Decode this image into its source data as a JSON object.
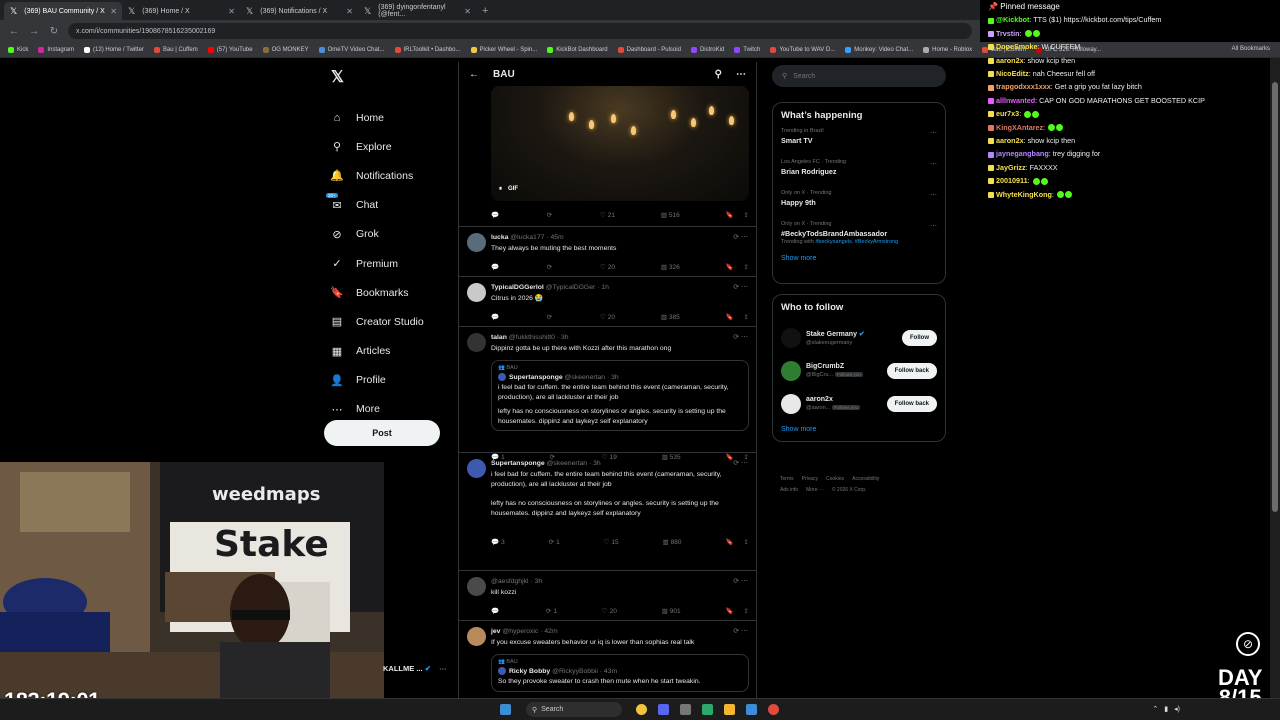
{
  "browser": {
    "tabs": [
      {
        "title": "(369) BAU Community / X",
        "active": true
      },
      {
        "title": "(369) Home / X",
        "active": false
      },
      {
        "title": "(369) Notifications / X",
        "active": false
      },
      {
        "title": "(369) dyingonfentanyl (@fent...",
        "active": false
      }
    ],
    "url": "x.com/i/communities/1908678516235002169",
    "bookmarks": [
      "Kick",
      "Instagram",
      "(12) Home / Twitter",
      "Bau | Cuffem",
      "(57) YouTube",
      "OG MONKEY",
      "OmeTV Video Chat...",
      "IRLToolkit • Dashbo...",
      "Picker Wheel - Spin...",
      "KickBot Dashboard",
      "Dashboard - Pulsoid",
      "DistroKid",
      "Twitch",
      "YouTube to WAV D...",
      "Monkey: Video Chat...",
      "Home - Roblox",
      "Bau | Cuffem",
      "UFC 326: Holloway..."
    ],
    "all_bookmarks": "All Bookmarks"
  },
  "x": {
    "logo": "𝕏",
    "nav": [
      {
        "label": "Home",
        "icon": "home-icon",
        "glyph": "⌂"
      },
      {
        "label": "Explore",
        "icon": "search-icon",
        "glyph": "⚲"
      },
      {
        "label": "Notifications",
        "icon": "bell-icon",
        "glyph": "🔔"
      },
      {
        "label": "Chat",
        "icon": "chat-icon",
        "glyph": "✉",
        "badge": "20+"
      },
      {
        "label": "Grok",
        "icon": "grok-icon",
        "glyph": "⊘"
      },
      {
        "label": "Premium",
        "icon": "premium-icon",
        "glyph": "✓"
      },
      {
        "label": "Bookmarks",
        "icon": "bookmark-icon",
        "glyph": "🔖"
      },
      {
        "label": "Creator Studio",
        "icon": "creator-studio-icon",
        "glyph": "▤"
      },
      {
        "label": "Articles",
        "icon": "articles-icon",
        "glyph": "▦"
      },
      {
        "label": "Profile",
        "icon": "profile-icon",
        "glyph": "👤"
      },
      {
        "label": "More",
        "icon": "more-icon",
        "glyph": "⋯"
      }
    ],
    "post_label": "Post",
    "account_name": "KALLME ...",
    "feed_title": "BAU",
    "gif_label": "GIF",
    "gif_actions": {
      "replies": "",
      "reposts": "",
      "likes": "21",
      "views": "516"
    },
    "tweets": [
      {
        "name": "lucka",
        "handle": "@lucka177",
        "time": "45m",
        "text": "They always be muting the best moments",
        "replies": "",
        "reposts": "",
        "likes": "20",
        "views": "326"
      },
      {
        "name": "TypicalDGGerlol",
        "handle": "@TypicalDGGer",
        "time": "1h",
        "text": "Citrus in 2026 😭",
        "replies": "",
        "reposts": "",
        "likes": "20",
        "views": "385"
      },
      {
        "name": "talan",
        "handle": "@fukkthisshitt0",
        "time": "3h",
        "text": "Dippinz gotta be up there with Kozzi after this marathon ong",
        "quote": {
          "community": "BAU",
          "name": "Supertansponge",
          "handle": "@skeenertan",
          "time": "3h",
          "text": "i feel bad for cuffem. the entire team behind this event (cameraman, security, production), are all lackluster at their job",
          "text2": "lefty has no consciousness on storylines or angles. security is setting up the housemates. dippinz and laykeyz self explanatory"
        },
        "replies": "1",
        "reposts": "",
        "likes": "19",
        "views": "535"
      },
      {
        "name": "Supertansponge",
        "handle": "@skeenertan",
        "time": "3h",
        "text": "i feel bad for cuffem. the entire team behind this event (cameraman, security, production), are all lackluster at their job",
        "text2": "lefty has no consciousness on storylines or angles. security is setting up the housemates. dippinz and laykeyz self explanatory",
        "replies": "3",
        "reposts": "1",
        "likes": "15",
        "views": "880"
      },
      {
        "name": "",
        "handle": "@aesfdghjkl",
        "time": "3h",
        "text": "kill kozzi",
        "replies": "",
        "reposts": "1",
        "likes": "20",
        "views": "901"
      },
      {
        "name": "jev",
        "handle": "@hyperoxic",
        "time": "42m",
        "text": "If you excuse sweaters behavior ur iq is lower than sophias real talk",
        "quote": {
          "community": "BAU",
          "name": "Ricky Bobby",
          "handle": "@RickyyBobbii",
          "time": "43m",
          "text": "So they provoke sweater to crash then mute when he start tweakin."
        },
        "replies": "",
        "reposts": "",
        "likes": "",
        "views": ""
      }
    ],
    "search_placeholder": "Search",
    "whats_happening": "What’s happening",
    "trends": [
      {
        "meta": "Trending in Brazil",
        "name": "Smart TV",
        "sub": ""
      },
      {
        "meta": "Los Angeles FC · Trending",
        "name": "Brian Rodriguez",
        "sub": ""
      },
      {
        "meta": "Only on X · Trending",
        "name": "Happy 9th",
        "sub": ""
      },
      {
        "meta": "Only on X · Trending",
        "name": "#BeckyTodsBrandAmbassador",
        "sub_prefix": "Trending with",
        "sub": "#beckysangels, #BeckyArmstrong"
      }
    ],
    "show_more": "Show more",
    "who_to_follow": "Who to follow",
    "follows": [
      {
        "name": "Stake Germany",
        "handle": "@stakeeugermany",
        "button": "Follow",
        "follows_you": ""
      },
      {
        "name": "BigCrumbZ",
        "handle": "@BigCru...",
        "button": "Follow back",
        "follows_you": "Follows you"
      },
      {
        "name": "aaron2x",
        "handle": "@aaron...",
        "button": "Follow back",
        "follows_you": "Follows you"
      }
    ],
    "footer": [
      "Terms",
      "Privacy",
      "Cookies",
      "Accessibility",
      "Ads info",
      "More ···",
      "© 2026 X Corp."
    ]
  },
  "chat": {
    "pinned_label": "Pinned message",
    "messages": [
      {
        "user": "@Kickbot",
        "color": "#53fc18",
        "text": "TTS ($1) https://kickbot.com/tips/Cuffem"
      },
      {
        "user": "Trvstin",
        "color": "#c9a0ff",
        "text": ""
      },
      {
        "user": "DopeSmoke",
        "color": "#f4e04d",
        "text": "W CUFFEM"
      },
      {
        "user": "aaron2x",
        "color": "#f4e04d",
        "text": "show kcip then"
      },
      {
        "user": "NicoEditz",
        "color": "#f4e04d",
        "text": "nah Cheesur fell off"
      },
      {
        "user": "trapgodxxx1xxx",
        "color": "#f4a261",
        "text": "Get a grip you fat lazy bitch"
      },
      {
        "user": "alllnwanted",
        "color": "#e85cff",
        "text": "CAP ON GOD MARATHONS GET BOOSTED KCIP"
      },
      {
        "user": "eur7x3",
        "color": "#f4e04d",
        "text": ""
      },
      {
        "user": "KingXAntarez",
        "color": "#e07a5f",
        "text": ""
      },
      {
        "user": "aaron2x",
        "color": "#f4e04d",
        "text": "show kcip then"
      },
      {
        "user": "jaynegangbang",
        "color": "#b388ff",
        "text": "trey digging for"
      },
      {
        "user": "JayGrizz",
        "color": "#f4e04d",
        "text": "FAXXXX"
      },
      {
        "user": "20010911",
        "color": "#f4e04d",
        "text": ""
      },
      {
        "user": "WhyteKingKong",
        "color": "#f4e04d",
        "text": ""
      }
    ]
  },
  "stream": {
    "timer": "183:19:01",
    "day_label": "DAY",
    "day_value": "8/15",
    "banner_text": "weedmaps",
    "sign_text": "Stake"
  },
  "taskbar": {
    "search_label": "Search"
  }
}
